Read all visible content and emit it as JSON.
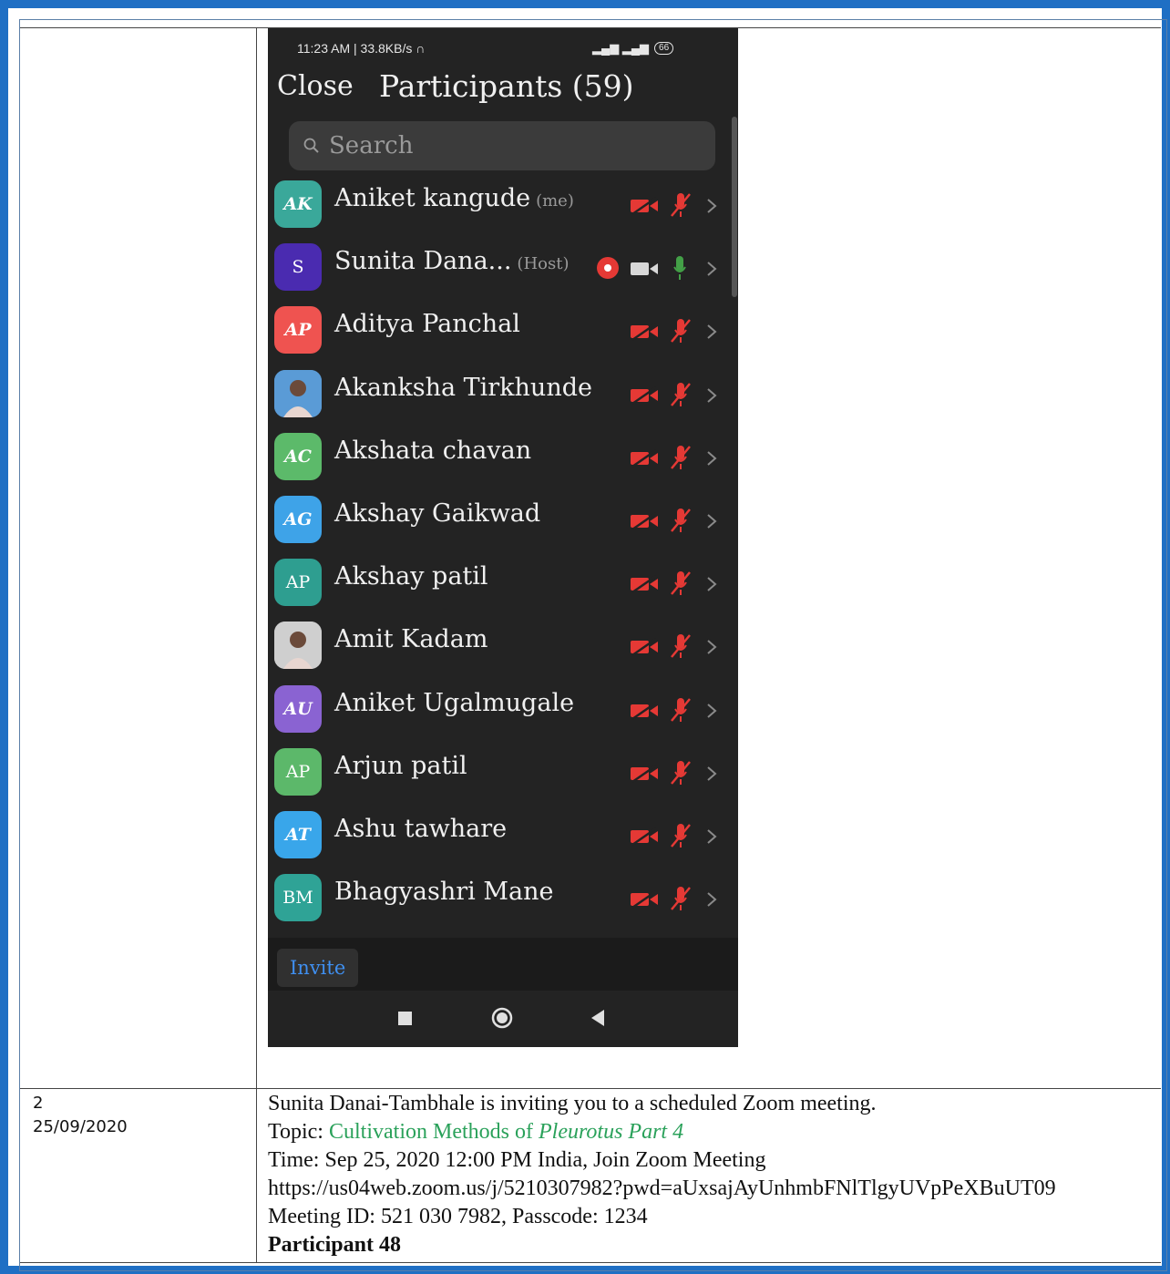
{
  "phone": {
    "status_left": "11:23 AM | 33.8KB/s",
    "battery": "66",
    "close_label": "Close",
    "title": "Participants (59)",
    "search_placeholder": "Search",
    "invite_label": "Invite",
    "participants": [
      {
        "initials": "AK",
        "name": "Aniket kangude",
        "tag": "(me)",
        "color": "#3aa89a",
        "style": "script"
      },
      {
        "initials": "S",
        "name": "Sunita Dana...",
        "tag": "(Host)",
        "color": "#4a2bb0",
        "style": "plain",
        "host": true
      },
      {
        "initials": "AP",
        "name": "Aditya Panchal",
        "tag": "",
        "color": "#ef5350",
        "style": "script"
      },
      {
        "initials": "",
        "name": "Akanksha Tirkhunde",
        "tag": "",
        "color": "#5a9bd6",
        "style": "photo"
      },
      {
        "initials": "AC",
        "name": "Akshata chavan",
        "tag": "",
        "color": "#5cba6a",
        "style": "script"
      },
      {
        "initials": "AG",
        "name": "Akshay Gaikwad",
        "tag": "",
        "color": "#3ea3e8",
        "style": "script"
      },
      {
        "initials": "AP",
        "name": "Akshay patil",
        "tag": "",
        "color": "#2e9e90",
        "style": "plain"
      },
      {
        "initials": "",
        "name": "Amit Kadam",
        "tag": "",
        "color": "#cfcfcf",
        "style": "photo"
      },
      {
        "initials": "AU",
        "name": "Aniket Ugalmugale",
        "tag": "",
        "color": "#8a63d2",
        "style": "script"
      },
      {
        "initials": "AP",
        "name": "Arjun patil",
        "tag": "",
        "color": "#5cb86a",
        "style": "plain"
      },
      {
        "initials": "AT",
        "name": "Ashu tawhare",
        "tag": "",
        "color": "#39a6ea",
        "style": "script"
      },
      {
        "initials": "BM",
        "name": "Bhagyashri Mane",
        "tag": "",
        "color": "#2fa396",
        "style": "plain"
      }
    ]
  },
  "entry": {
    "number": "2",
    "date": "25/09/2020",
    "invite_text": "Sunita Danai-Tambhale is inviting you to a scheduled Zoom meeting.",
    "topic_label": "Topic: ",
    "topic_value": "Cultivation Methods of ",
    "topic_italic": "Pleurotus Part 4",
    "time": "Time: Sep 25, 2020 12:00 PM India, Join Zoom Meeting",
    "url": "https://us04web.zoom.us/j/5210307982?pwd=aUxsajAyUnhmbFNlTlgyUVpPeXBuUT09",
    "meeting_id": "Meeting ID: 521 030 7982, Passcode: 1234",
    "participant": "Participant 48"
  },
  "colors": {
    "border": "#1f6fc4",
    "muted_red": "#e53935",
    "mic_green": "#43a047",
    "link_green": "#2aa15a"
  }
}
